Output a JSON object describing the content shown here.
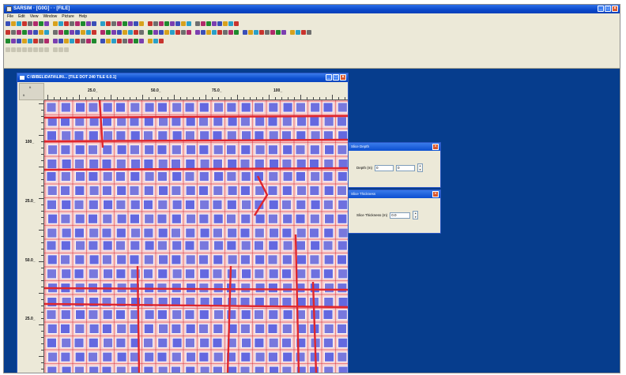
{
  "app": {
    "title": "SARSIM · [G0G] ·  · [FILE]"
  },
  "menu": [
    "File",
    "Edit",
    "View",
    "Window",
    "Picture",
    "Help"
  ],
  "child_window": {
    "title": "C:\\BIBEL\\DATA\\LIN\\... [TILE DOT 240 TILE 6.0.1]"
  },
  "rulers": {
    "corner": {
      "top": "ft",
      "bottom": "ft"
    },
    "horizontal": [
      "25.0_",
      "50.0_",
      "75.0_",
      "100_"
    ],
    "vertical": [
      "100_",
      "25.0_",
      "50.0_",
      "25.0_"
    ]
  },
  "palettes": {
    "slice_depth": {
      "title": "Slice Depth",
      "label": "Depth (m)",
      "value1": "0",
      "value2": "0"
    },
    "slice_thickness": {
      "title": "Slice Thickness",
      "label": "Slice Thickness (m)",
      "value": "0.0"
    }
  },
  "colors": {
    "desktop": "#063d8d",
    "tile_blue": "#5961e0",
    "grout_red": "#e0262c",
    "background_pink": "#f6d3d3"
  },
  "toolbar_icon_colors": [
    "#3a4fb8",
    "#c8342e",
    "#1f8a2e",
    "#d7a21d",
    "#6e6e6e",
    "#7b3fb0",
    "#2aa0c8",
    "#b02a6b"
  ]
}
